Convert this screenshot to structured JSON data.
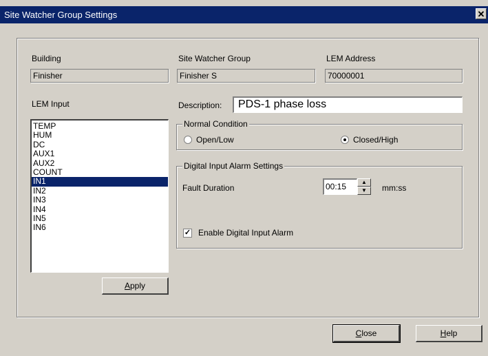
{
  "window": {
    "title": "Site Watcher Group Settings",
    "close_glyph": "✕"
  },
  "building": {
    "label": "Building",
    "value": "Finisher"
  },
  "site_watcher_group": {
    "label": "Site Watcher Group",
    "value": "Finisher S"
  },
  "lem_address": {
    "label": "LEM Address",
    "value": "70000001"
  },
  "lem_input": {
    "label": "LEM Input",
    "items": [
      "TEMP",
      "HUM",
      "DC",
      "AUX1",
      "AUX2",
      "COUNT",
      "IN1",
      "IN2",
      "IN3",
      "IN4",
      "IN5",
      "IN6"
    ],
    "selected": "IN1"
  },
  "description": {
    "label": "Description:",
    "value": "PDS-1 phase loss"
  },
  "normal_condition": {
    "legend": "Normal Condition",
    "open_low": "Open/Low",
    "closed_high": "Closed/High",
    "selected": "Closed/High"
  },
  "alarm_settings": {
    "legend": "Digital Input Alarm Settings",
    "fault_duration_label": "Fault Duration",
    "fault_duration_value": "00:15",
    "unit": "mm:ss",
    "enable_label": "Enable Digital Input Alarm",
    "enable_checked": true
  },
  "buttons": {
    "apply_mnemonic": "A",
    "apply_rest": "pply",
    "close_mnemonic": "C",
    "close_rest": "lose",
    "help_mnemonic": "H",
    "help_rest": "elp"
  },
  "colors": {
    "face": "#d4d0c8",
    "title_bar": "#0a246a",
    "selection": "#0a246a"
  }
}
